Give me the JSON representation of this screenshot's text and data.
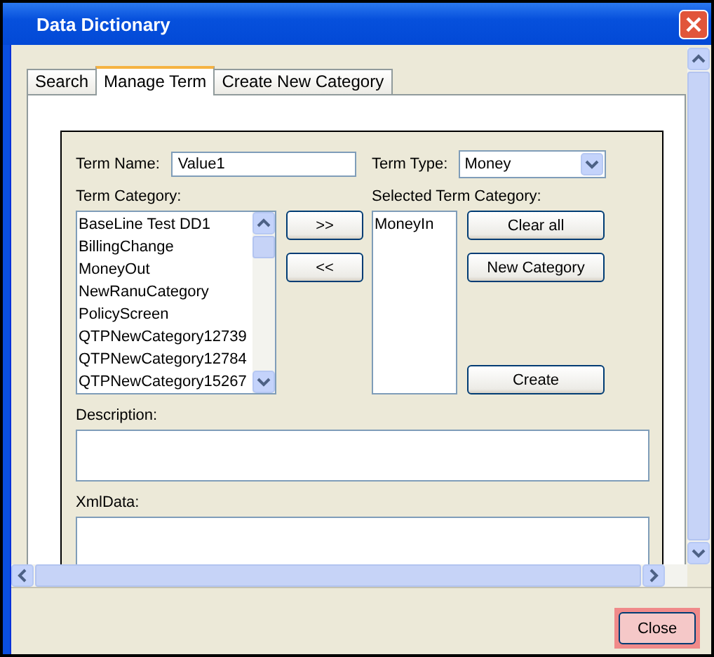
{
  "window": {
    "title": "Data Dictionary"
  },
  "tabs": [
    {
      "label": "Search",
      "selected": false
    },
    {
      "label": "Manage Term",
      "selected": true
    },
    {
      "label": "Create New Category",
      "selected": false
    }
  ],
  "form": {
    "term_name": {
      "label": "Term Name:",
      "value": "Value1"
    },
    "term_type": {
      "label": "Term Type:",
      "value": "Money"
    },
    "term_category": {
      "label": "Term Category:",
      "items": [
        "BaseLine Test DD1",
        "BillingChange",
        "MoneyOut",
        "NewRanuCategory",
        "PolicyScreen",
        "QTPNewCategory12739",
        "QTPNewCategory12784",
        "QTPNewCategory15267"
      ]
    },
    "move_buttons": [
      ">>",
      "<<"
    ],
    "selected_term_category": {
      "label": "Selected Term Category:",
      "items": [
        "MoneyIn"
      ]
    },
    "action_buttons": [
      "Clear all",
      "New Category",
      "Create"
    ],
    "description": {
      "label": "Description:"
    },
    "xml_data": {
      "label": "XmlData:"
    }
  },
  "footer": {
    "buttons": [
      {
        "label": "Close",
        "focused": true
      }
    ]
  }
}
